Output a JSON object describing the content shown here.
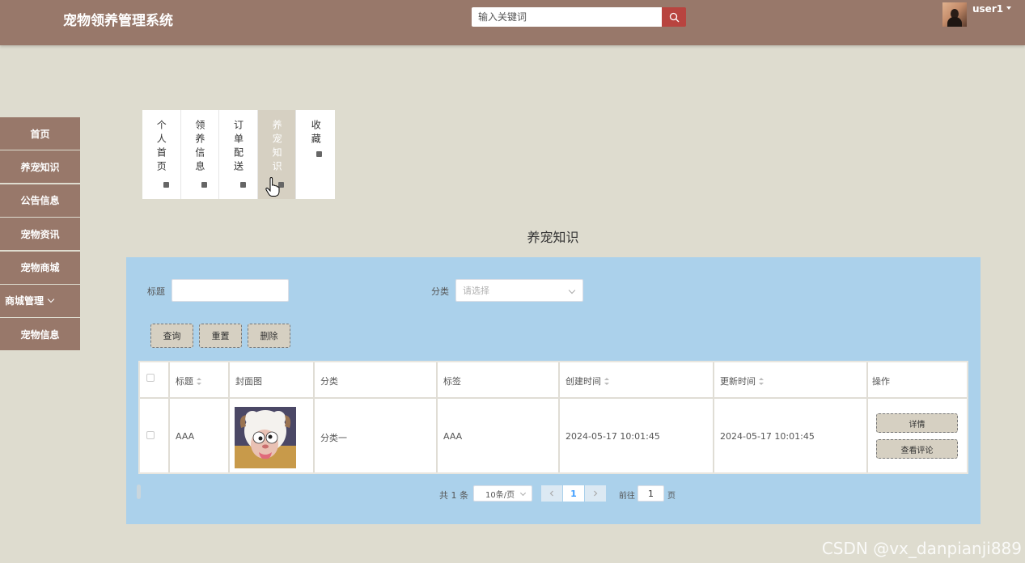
{
  "header": {
    "app_title": "宠物领养管理系统",
    "search_placeholder": "输入关键词",
    "username": "user1"
  },
  "sidebar": {
    "items": [
      {
        "label": "首页"
      },
      {
        "label": "养宠知识"
      },
      {
        "label": "公告信息"
      },
      {
        "label": "宠物资讯"
      },
      {
        "label": "宠物商城"
      },
      {
        "label": "商城管理"
      },
      {
        "label": "宠物信息"
      }
    ]
  },
  "tabs": [
    {
      "label": "个人首页"
    },
    {
      "label": "领养信息"
    },
    {
      "label": "订单配送"
    },
    {
      "label": "养宠知识"
    },
    {
      "label": "收藏"
    }
  ],
  "section_title": "养宠知识",
  "filters": {
    "title_label": "标题",
    "title_value": "",
    "category_label": "分类",
    "category_placeholder": "请选择"
  },
  "actions": {
    "query": "查询",
    "reset": "重置",
    "delete": "删除"
  },
  "table": {
    "headers": {
      "title": "标题",
      "cover": "封面图",
      "category": "分类",
      "tags": "标签",
      "created": "创建时间",
      "updated": "更新时间",
      "ops": "操作"
    },
    "rows": [
      {
        "title": "AAA",
        "category": "分类一",
        "tags": "AAA",
        "created": "2024-05-17 10:01:45",
        "updated": "2024-05-17 10:01:45",
        "detail": "详情",
        "comments": "查看评论"
      }
    ]
  },
  "pagination": {
    "total": "共 1 条",
    "page_size": "10条/页",
    "current": "1",
    "goto_label": "前往",
    "goto_value": "1",
    "page_suffix": "页"
  },
  "watermark": "CSDN @vx_danpianji889",
  "colors": {
    "header_bg": "#98786a",
    "page_bg": "#dedccf",
    "panel_bg": "#abd1eb",
    "button_bg": "#d6d0c2",
    "search_button": "#b8443f"
  }
}
